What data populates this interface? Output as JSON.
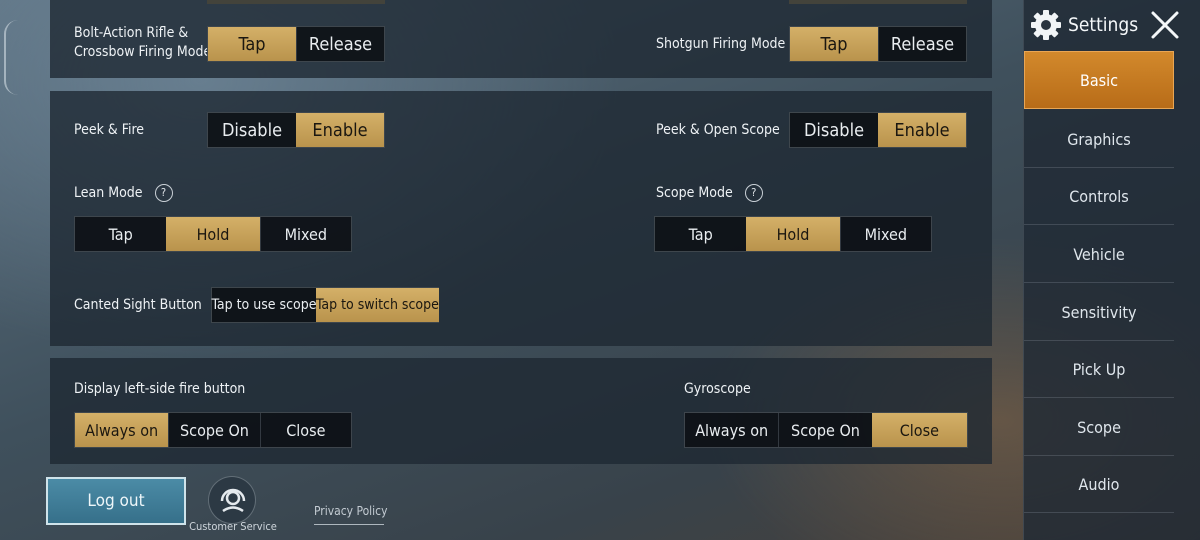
{
  "sidebar": {
    "title": "Settings",
    "items": [
      {
        "label": "Basic"
      },
      {
        "label": "Graphics"
      },
      {
        "label": "Controls"
      },
      {
        "label": "Vehicle"
      },
      {
        "label": "Sensitivity"
      },
      {
        "label": "Pick Up"
      },
      {
        "label": "Scope"
      },
      {
        "label": "Audio"
      }
    ]
  },
  "firing": {
    "bolt_label_line1": "Bolt-Action Rifle &",
    "bolt_label_line2": "Crossbow Firing Mode",
    "bolt_options": [
      "Tap",
      "Release"
    ],
    "shotgun_label": "Shotgun Firing Mode",
    "shotgun_options": [
      "Tap",
      "Release"
    ]
  },
  "peek": {
    "peek_fire_label": "Peek & Fire",
    "peek_fire_options": [
      "Disable",
      "Enable"
    ],
    "peek_scope_label": "Peek & Open Scope",
    "peek_scope_options": [
      "Disable",
      "Enable"
    ],
    "lean_label": "Lean Mode",
    "lean_options": [
      "Tap",
      "Hold",
      "Mixed"
    ],
    "scope_mode_label": "Scope Mode",
    "scope_mode_options": [
      "Tap",
      "Hold",
      "Mixed"
    ],
    "canted_label": "Canted Sight Button",
    "canted_options": [
      "Tap to use scope",
      "Tap to switch scope"
    ],
    "help_glyph": "?"
  },
  "fire_button": {
    "left_fire_label": "Display left-side fire button",
    "left_fire_options": [
      "Always on",
      "Scope On",
      "Close"
    ],
    "gyro_label": "Gyroscope",
    "gyro_options": [
      "Always on",
      "Scope On",
      "Close"
    ]
  },
  "footer": {
    "logout_label": "Log out",
    "customer_service_label": "Customer Service",
    "privacy_label": "Privacy Policy"
  },
  "colors": {
    "selected_gold": "#c9a55e",
    "active_orange": "#c97a22",
    "logout_blue": "#3f7f99"
  }
}
